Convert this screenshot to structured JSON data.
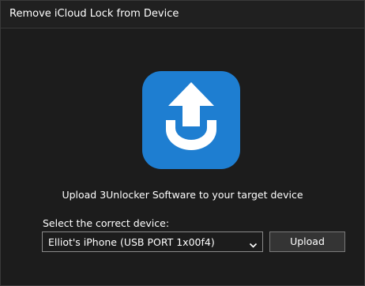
{
  "window": {
    "title": "Remove iCloud Lock from Device"
  },
  "main": {
    "icon": "upload-arrow-icon",
    "icon_color": "#1e7ed1",
    "message": "Upload 3Unlocker Software to your target device",
    "device_label": "Select the correct device:",
    "device_select": {
      "selected": "Elliot's iPhone (USB PORT 1x00f4)"
    },
    "upload_button": "Upload"
  }
}
